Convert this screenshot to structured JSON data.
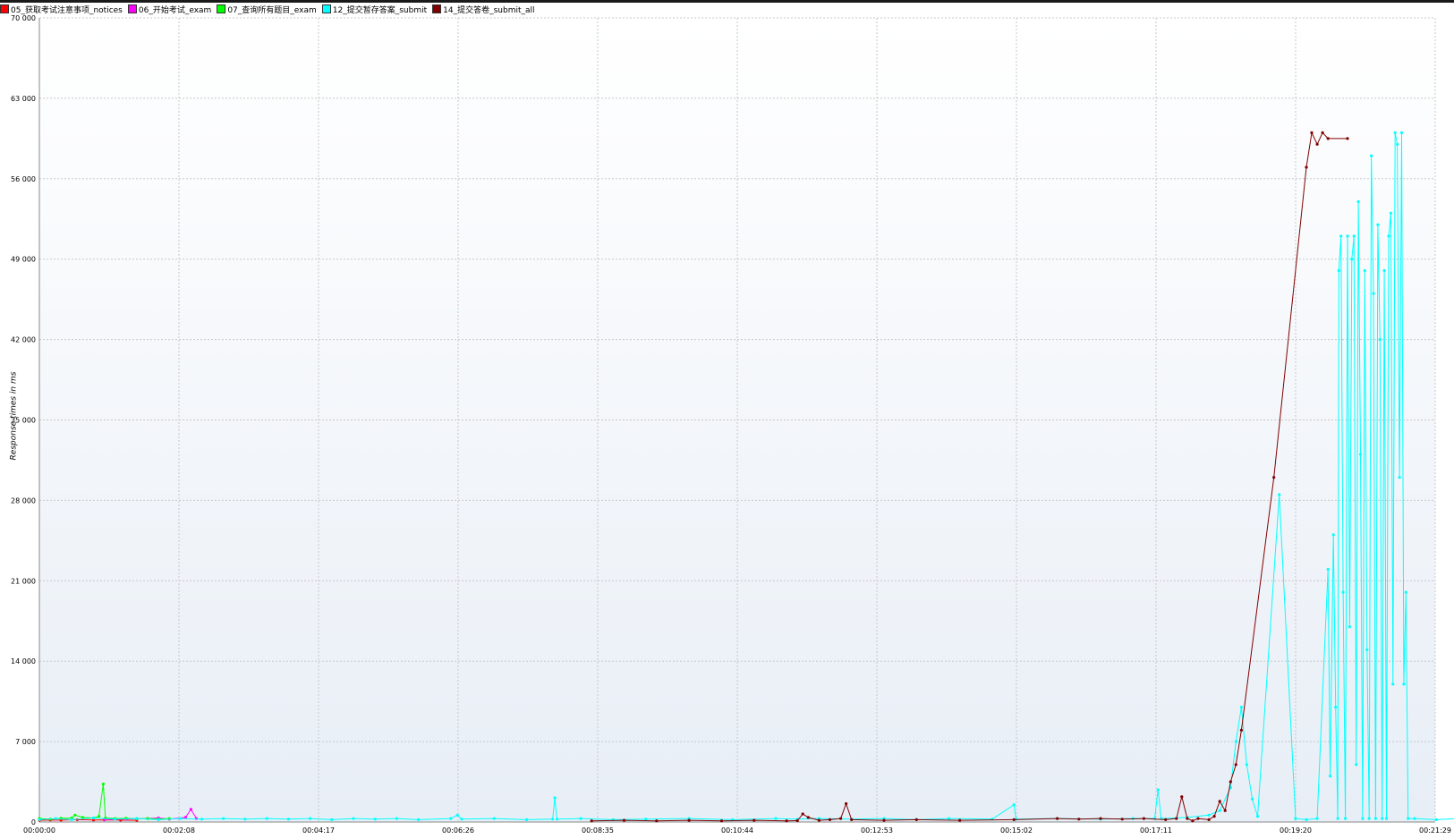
{
  "legend": [
    {
      "label": "05_获取考试注意事项_notices",
      "color": "#ff0000"
    },
    {
      "label": "06_开始考试_exam",
      "color": "#ff00ff"
    },
    {
      "label": "07_查询所有题目_exam",
      "color": "#00ff00"
    },
    {
      "label": "12_提交暂存答案_submit",
      "color": "#00ffff"
    },
    {
      "label": "14_提交答卷_submit_all",
      "color": "#800000"
    }
  ],
  "chart_data": {
    "type": "line",
    "title": "",
    "xlabel": "",
    "ylabel": "Response times in ms",
    "xlim": [
      "00:00:00",
      "00:21:29"
    ],
    "ylim": [
      0,
      70000
    ],
    "y_ticks": [
      "0",
      "7 000",
      "14 000",
      "21 000",
      "28 000",
      "35 000",
      "42 000",
      "49 000",
      "56 000",
      "63 000",
      "70 000"
    ],
    "x_ticks": [
      "00:00:00",
      "00:02:08",
      "00:04:17",
      "00:06:26",
      "00:08:35",
      "00:10:44",
      "00:12:53",
      "00:15:02",
      "00:17:11",
      "00:19:20",
      "00:21:29"
    ],
    "grid": true,
    "legend_position": "top-left",
    "series": [
      {
        "name": "05_获取考试注意事项_notices",
        "color": "#ff0000",
        "points": [
          [
            0,
            150
          ],
          [
            10,
            180
          ],
          [
            20,
            160
          ],
          [
            35,
            200
          ],
          [
            50,
            170
          ],
          [
            60,
            190
          ],
          [
            75,
            160
          ],
          [
            90,
            150
          ]
        ]
      },
      {
        "name": "06_开始考试_exam",
        "color": "#ff00ff",
        "points": [
          [
            60,
            200
          ],
          [
            80,
            250
          ],
          [
            100,
            300
          ],
          [
            110,
            350
          ],
          [
            120,
            250
          ],
          [
            135,
            400
          ],
          [
            140,
            1100
          ],
          [
            145,
            300
          ]
        ]
      },
      {
        "name": "07_查询所有题目_exam",
        "color": "#00ff00",
        "points": [
          [
            0,
            300
          ],
          [
            10,
            250
          ],
          [
            20,
            320
          ],
          [
            30,
            350
          ],
          [
            33,
            600
          ],
          [
            40,
            400
          ],
          [
            50,
            350
          ],
          [
            55,
            500
          ],
          [
            59,
            3300
          ],
          [
            61,
            350
          ],
          [
            70,
            300
          ],
          [
            80,
            320
          ],
          [
            90,
            280
          ],
          [
            100,
            300
          ],
          [
            110,
            250
          ],
          [
            120,
            300
          ]
        ]
      },
      {
        "name": "12_提交暂存答案_submit",
        "color": "#00ffff",
        "points": [
          [
            0,
            200
          ],
          [
            15,
            300
          ],
          [
            30,
            200
          ],
          [
            50,
            350
          ],
          [
            70,
            250
          ],
          [
            90,
            300
          ],
          [
            110,
            200
          ],
          [
            130,
            300
          ],
          [
            150,
            250
          ],
          [
            170,
            300
          ],
          [
            190,
            250
          ],
          [
            210,
            300
          ],
          [
            230,
            250
          ],
          [
            250,
            300
          ],
          [
            270,
            200
          ],
          [
            290,
            300
          ],
          [
            310,
            250
          ],
          [
            330,
            300
          ],
          [
            350,
            200
          ],
          [
            380,
            300
          ],
          [
            386,
            600
          ],
          [
            390,
            250
          ],
          [
            420,
            300
          ],
          [
            450,
            200
          ],
          [
            474,
            250
          ],
          [
            476,
            2100
          ],
          [
            478,
            250
          ],
          [
            500,
            300
          ],
          [
            530,
            200
          ],
          [
            560,
            250
          ],
          [
            600,
            300
          ],
          [
            640,
            200
          ],
          [
            680,
            300
          ],
          [
            700,
            250
          ],
          [
            720,
            300
          ],
          [
            750,
            250
          ],
          [
            780,
            300
          ],
          [
            810,
            200
          ],
          [
            840,
            300
          ],
          [
            880,
            250
          ],
          [
            900,
            1500
          ],
          [
            902,
            250
          ],
          [
            940,
            300
          ],
          [
            980,
            250
          ],
          [
            1010,
            300
          ],
          [
            1030,
            300
          ],
          [
            1033,
            2800
          ],
          [
            1036,
            300
          ],
          [
            1060,
            400
          ],
          [
            1080,
            600
          ],
          [
            1090,
            1000
          ],
          [
            1100,
            3000
          ],
          [
            1105,
            7000
          ],
          [
            1110,
            10000
          ],
          [
            1115,
            5000
          ],
          [
            1120,
            2000
          ],
          [
            1125,
            500
          ],
          [
            1145,
            28500
          ],
          [
            1160,
            300
          ],
          [
            1170,
            200
          ],
          [
            1180,
            300
          ],
          [
            1190,
            22000
          ],
          [
            1192,
            4000
          ],
          [
            1195,
            25000
          ],
          [
            1197,
            10000
          ],
          [
            1199,
            300
          ],
          [
            1200,
            48000
          ],
          [
            1202,
            51000
          ],
          [
            1204,
            20000
          ],
          [
            1206,
            300
          ],
          [
            1208,
            51000
          ],
          [
            1210,
            17000
          ],
          [
            1212,
            49000
          ],
          [
            1214,
            51000
          ],
          [
            1216,
            5000
          ],
          [
            1218,
            54000
          ],
          [
            1220,
            32000
          ],
          [
            1222,
            300
          ],
          [
            1224,
            48000
          ],
          [
            1226,
            15000
          ],
          [
            1228,
            300
          ],
          [
            1230,
            58000
          ],
          [
            1232,
            46000
          ],
          [
            1234,
            300
          ],
          [
            1236,
            52000
          ],
          [
            1238,
            42000
          ],
          [
            1240,
            300
          ],
          [
            1242,
            48000
          ],
          [
            1244,
            300
          ],
          [
            1246,
            51000
          ],
          [
            1248,
            53000
          ],
          [
            1250,
            12000
          ],
          [
            1252,
            60000
          ],
          [
            1254,
            59000
          ],
          [
            1256,
            30000
          ],
          [
            1258,
            60000
          ],
          [
            1260,
            12000
          ],
          [
            1262,
            20000
          ],
          [
            1264,
            300
          ],
          [
            1270,
            300
          ],
          [
            1290,
            200
          ],
          [
            1310,
            300
          ]
        ]
      },
      {
        "name": "14_提交答卷_submit_all",
        "color": "#800000",
        "points": [
          [
            510,
            100
          ],
          [
            540,
            150
          ],
          [
            570,
            100
          ],
          [
            600,
            150
          ],
          [
            630,
            100
          ],
          [
            660,
            150
          ],
          [
            690,
            100
          ],
          [
            700,
            120
          ],
          [
            705,
            700
          ],
          [
            710,
            400
          ],
          [
            720,
            150
          ],
          [
            730,
            200
          ],
          [
            740,
            300
          ],
          [
            745,
            1600
          ],
          [
            750,
            200
          ],
          [
            780,
            150
          ],
          [
            810,
            200
          ],
          [
            850,
            150
          ],
          [
            900,
            200
          ],
          [
            940,
            300
          ],
          [
            960,
            250
          ],
          [
            980,
            300
          ],
          [
            1000,
            250
          ],
          [
            1020,
            300
          ],
          [
            1040,
            200
          ],
          [
            1050,
            300
          ],
          [
            1055,
            2200
          ],
          [
            1060,
            300
          ],
          [
            1065,
            100
          ],
          [
            1070,
            300
          ],
          [
            1080,
            200
          ],
          [
            1085,
            500
          ],
          [
            1090,
            1800
          ],
          [
            1095,
            1000
          ],
          [
            1100,
            3500
          ],
          [
            1105,
            5000
          ],
          [
            1110,
            8000
          ],
          [
            1140,
            30000
          ],
          [
            1170,
            57000
          ],
          [
            1175,
            60000
          ],
          [
            1180,
            59000
          ],
          [
            1185,
            60000
          ],
          [
            1190,
            59500
          ],
          [
            1208,
            59500
          ]
        ]
      }
    ]
  }
}
